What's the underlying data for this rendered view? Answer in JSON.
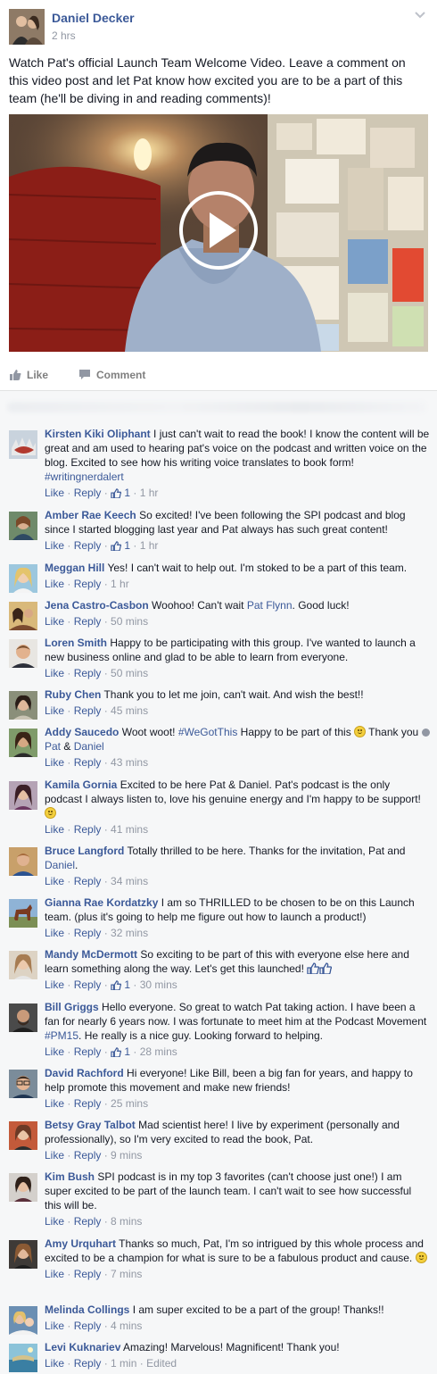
{
  "post": {
    "author": "Daniel Decker",
    "time": "2 hrs",
    "text": "Watch Pat's official Launch Team Welcome Video. Leave a comment on this video post and let Pat know how excited you are to be a part of this team (he'll be diving in and reading comments)!",
    "actions": {
      "like": "Like",
      "comment": "Comment"
    }
  },
  "comment_meta": {
    "like": "Like",
    "reply": "Reply",
    "sep": " · "
  },
  "comments": [
    {
      "name": "Kirsten Kiki Oliphant",
      "text": "I just can't wait to read the book! I know the content will be great and am used to hearing pat's voice on the podcast and written voice on the blog. Excited to see how his writing voice translates to book form! ",
      "tag": "#writingnerdalert",
      "likes": "1",
      "time": "1 hr"
    },
    {
      "name": "Amber Rae Keech",
      "text": "So excited! I've been following the SPI podcast and blog since I started blogging last year and Pat always has such great content!",
      "likes": "1",
      "time": "1 hr"
    },
    {
      "name": "Meggan Hill",
      "text": "Yes! I can't wait to help out. I'm stoked to be a part of this team.",
      "time": "1 hr"
    },
    {
      "name": "Jena Castro-Casbon",
      "text": "Woohoo! Can't wait ",
      "mention": "Pat Flynn",
      "text2": ". Good luck!",
      "time": "50 mins"
    },
    {
      "name": "Loren Smith",
      "text": "Happy to be participating with this group. I've wanted to launch a new business online and glad to be able to learn from everyone.",
      "time": "50 mins"
    },
    {
      "name": "Ruby Chen",
      "text": "Thank you to let me join, can't wait. And wish the best!!",
      "time": "45 mins"
    },
    {
      "name": "Addy Saucedo",
      "text": "Woot woot! ",
      "tag": "#WeGotThis",
      "text2": " Happy to be part of this ",
      "text3": " Thank you ",
      "with1": "Pat",
      "amp": " & ",
      "with2": "Daniel",
      "time": "43 mins"
    },
    {
      "name": "Kamila Gornia",
      "text": "Excited to be here Pat & Daniel. Pat's podcast is the only podcast I always listen to, love his genuine energy and I'm happy to be support! ",
      "time": "41 mins"
    },
    {
      "name": "Bruce Langford",
      "text": "Totally thrilled to be here. Thanks for the invitation, Pat and ",
      "mention": "Daniel",
      "text2": ".",
      "time": "34 mins"
    },
    {
      "name": "Gianna Rae Kordatzky",
      "text": "I am so THRILLED to be chosen to be on this Launch team. (plus it's going to help me figure out how to launch a product!)",
      "time": "32 mins"
    },
    {
      "name": "Mandy McDermott",
      "text": "So exciting to be part of this with everyone else here and learn something along the way. Let's get this launched! ",
      "likes": "1",
      "time": "30 mins"
    },
    {
      "name": "Bill Griggs",
      "text": "Hello everyone. So great to watch Pat taking action. I have been a fan for nearly 6 years now. I was fortunate to meet him at the Podcast Movement ",
      "tag": "#PM15",
      "text2": ". He really is a nice guy. Looking forward to helping.",
      "likes": "1",
      "time": "28 mins"
    },
    {
      "name": "David Rachford",
      "text": "Hi everyone! Like Bill, been a big fan for years, and happy to help promote this movement and make new friends!",
      "time": "25 mins"
    },
    {
      "name": "Betsy Gray Talbot",
      "text": "Mad scientist here! I live by experiment (personally and professionally), so I'm very excited to read the book, Pat.",
      "time": "9 mins"
    },
    {
      "name": "Kim Bush",
      "text": "SPI podcast is in my top 3 favorites (can't choose just one!) I am super excited to be part of the launch team. I can't wait to see how successful this will be.",
      "time": "8 mins"
    },
    {
      "name": "Amy Urquhart",
      "text": "Thanks so much, Pat, I'm so intrigued by this whole process and excited to be a champion for what is sure to be a fabulous product and cause. ",
      "time": "7 mins"
    },
    {
      "name": "Melinda Collings",
      "text": "I am super excited to be a part of the group! Thanks!!",
      "time": "4 mins"
    },
    {
      "name": "Levi Kuknariev",
      "text": "Amazing! Marvelous! Magnificent! Thank you!",
      "time": "1 min",
      "edited": "Edited"
    }
  ]
}
